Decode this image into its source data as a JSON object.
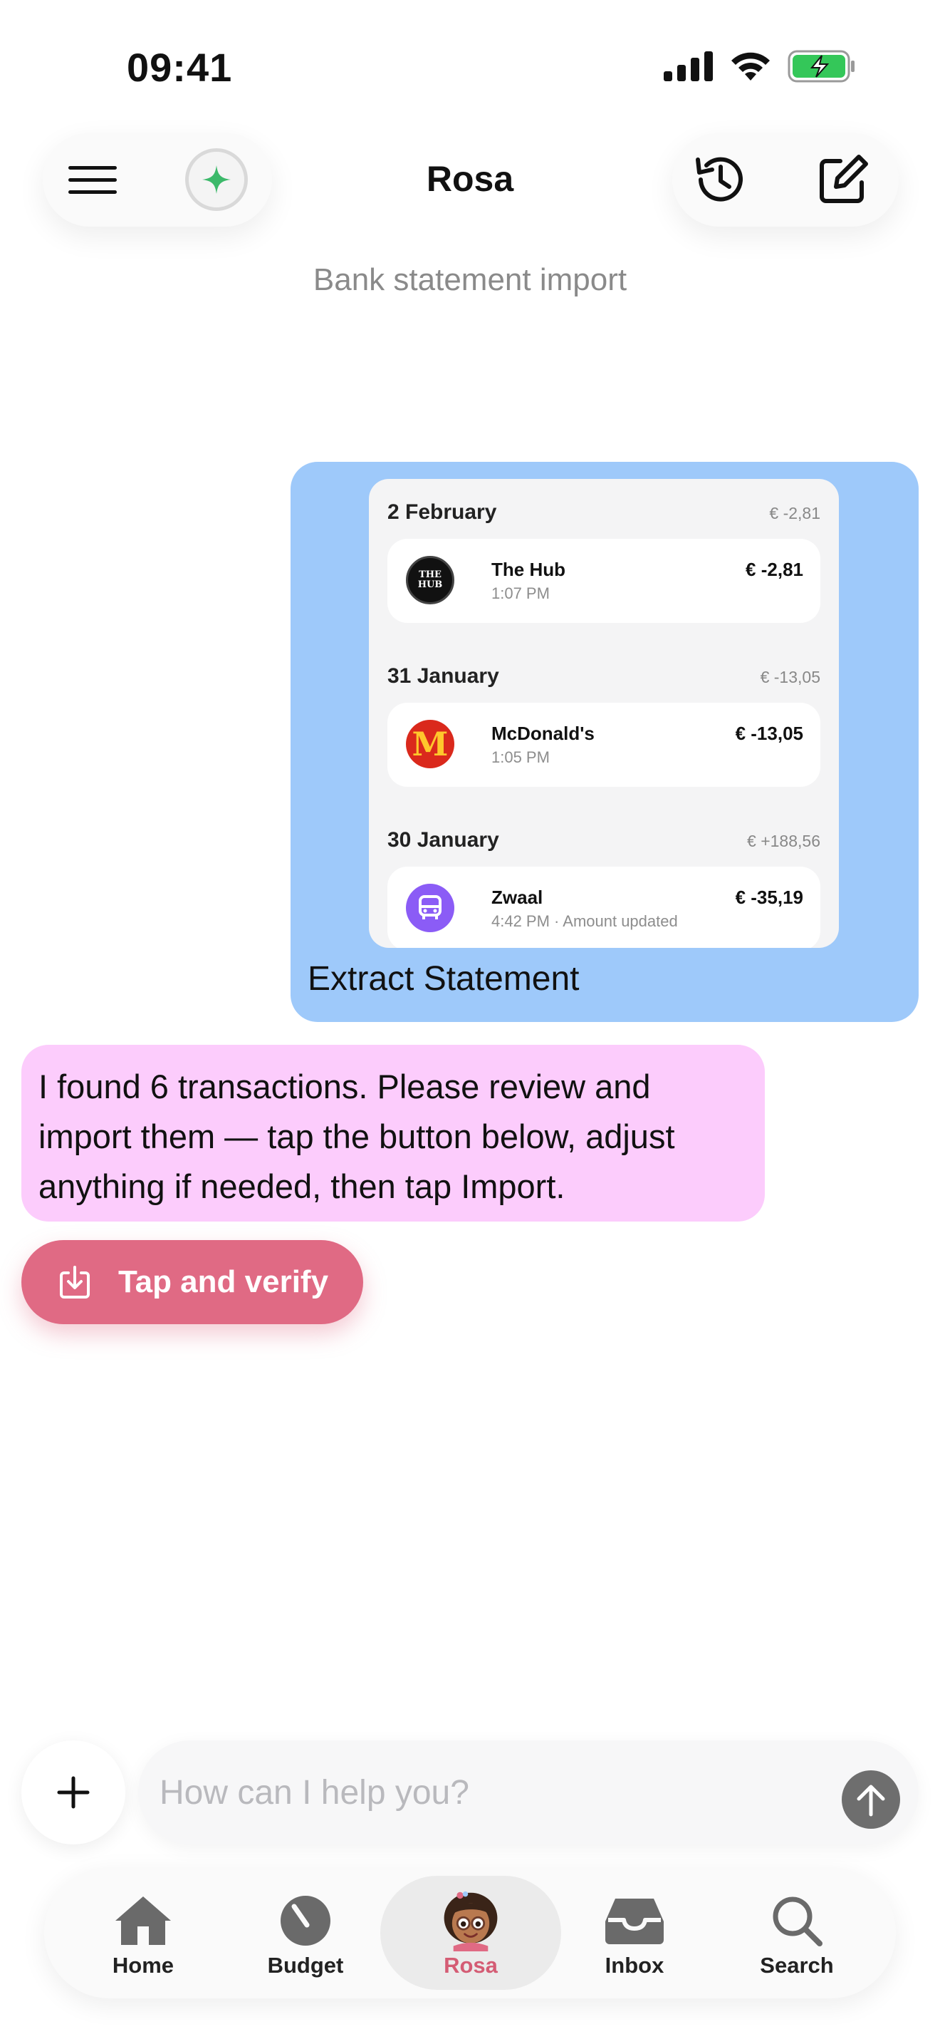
{
  "status_bar": {
    "time": "09:41",
    "icons": [
      "cellular-signal-icon",
      "wifi-icon",
      "battery-charging-icon"
    ]
  },
  "header": {
    "title": "Rosa",
    "subtitle": "Bank statement import",
    "left_buttons": [
      "menu-icon",
      "sparkle-icon"
    ],
    "right_buttons": [
      "history-icon",
      "compose-icon"
    ]
  },
  "user_message": {
    "attachment": {
      "days": [
        {
          "date": "2 February",
          "total": "€ -2,81",
          "transactions": [
            {
              "name": "The Hub",
              "time": "1:07 PM",
              "amount": "€ -2,81",
              "logo_text": "THE HUB"
            }
          ]
        },
        {
          "date": "31 January",
          "total": "€ -13,05",
          "transactions": [
            {
              "name": "McDonald's",
              "time": "1:05 PM",
              "amount": "€ -13,05",
              "logo_text": "M"
            }
          ]
        },
        {
          "date": "30 January",
          "total": "€ +188,56",
          "transactions": [
            {
              "name": "Zwaal",
              "time": "4:42 PM · Amount updated",
              "amount": "€ -35,19",
              "logo_text": ""
            }
          ]
        }
      ]
    },
    "text": "Extract Statement"
  },
  "assistant_message": {
    "text": "I found 6 transactions. Please review and import them — tap the button below, adjust anything if needed, then tap Import."
  },
  "action_button": {
    "label": "Tap and verify",
    "icon": "import-icon"
  },
  "composer": {
    "placeholder": "How can I help you?",
    "value": ""
  },
  "tabs": [
    {
      "label": "Home",
      "icon": "house-icon",
      "active": false
    },
    {
      "label": "Budget",
      "icon": "gauge-icon",
      "active": false
    },
    {
      "label": "Rosa",
      "icon": "rosa-avatar",
      "active": true
    },
    {
      "label": "Inbox",
      "icon": "inbox-tray-icon",
      "active": false
    },
    {
      "label": "Search",
      "icon": "search-icon",
      "active": false
    }
  ],
  "colors": {
    "user_bubble": "#9ec9fa",
    "assistant_bubble": "#fcccfc",
    "accent": "#e06a84",
    "active_tab_label": "#d45c74"
  }
}
